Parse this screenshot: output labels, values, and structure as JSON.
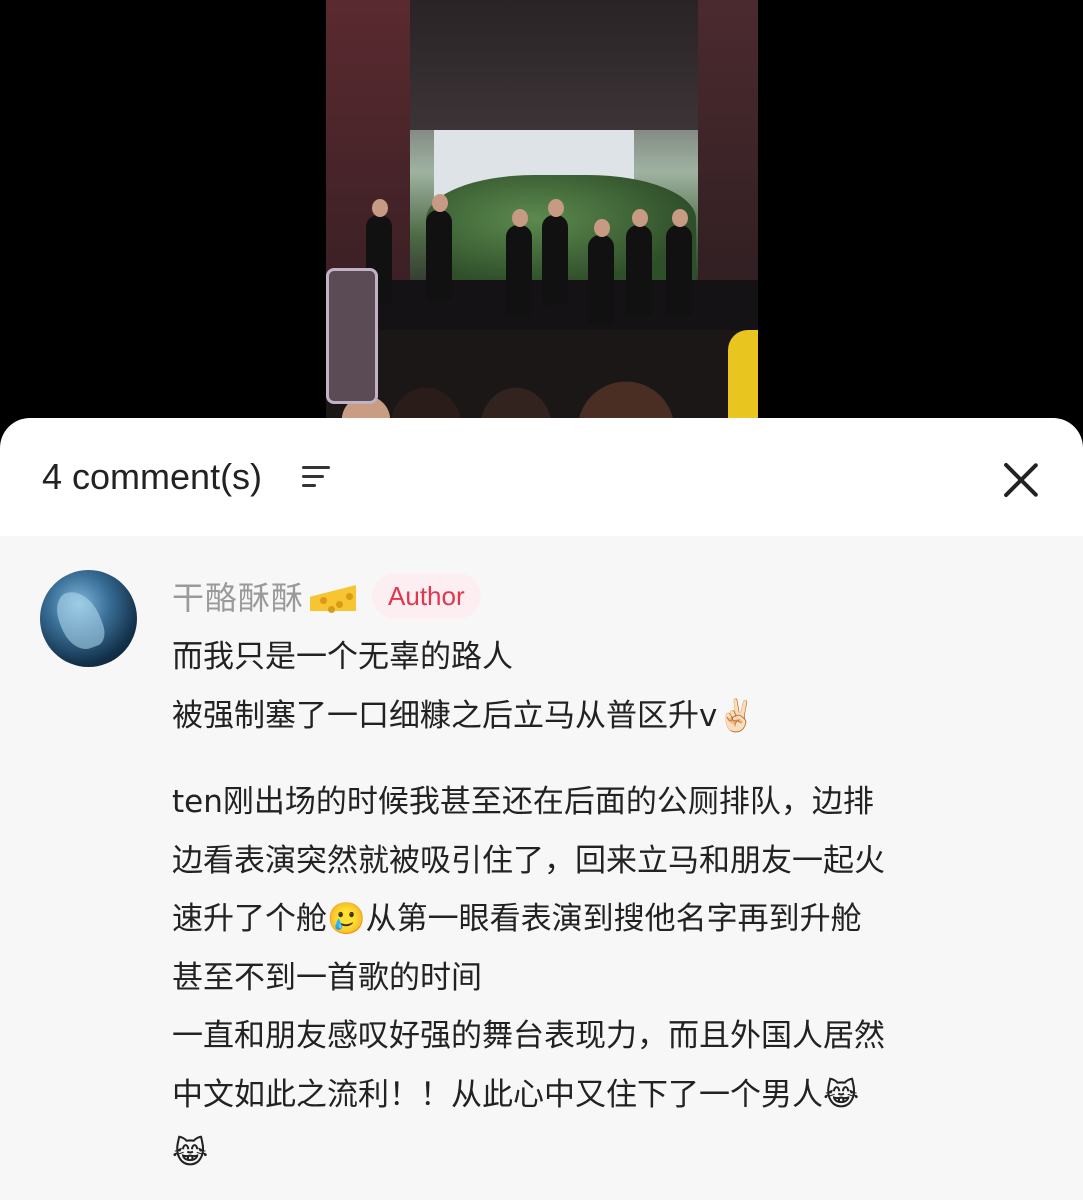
{
  "video": {
    "description_icon": "video-frame"
  },
  "sheet": {
    "comment_count_label": "4 comment(s)",
    "filter_icon": "sort-lines-icon",
    "close_icon": "close-icon"
  },
  "comments": [
    {
      "username": "干酪酥酥",
      "username_emoji": "cheese-icon",
      "badge": "Author",
      "lines": [
        "而我只是一个无辜的路人",
        "被强制塞了一口细糠之后立马从普区升v✌🏻"
      ],
      "paragraph2": [
        "ten刚出场的时候我甚至还在后面的公厕排队，边排",
        "边看表演突然就被吸引住了，回来立马和朋友一起火",
        "速升了个舱🥲从第一眼看表演到搜他名字再到升舱",
        "甚至不到一首歌的时间",
        "一直和朋友感叹好强的舞台表现力，而且外国人居然",
        "中文如此之流利！！从此心中又住下了一个男人😹",
        "😹"
      ]
    }
  ]
}
